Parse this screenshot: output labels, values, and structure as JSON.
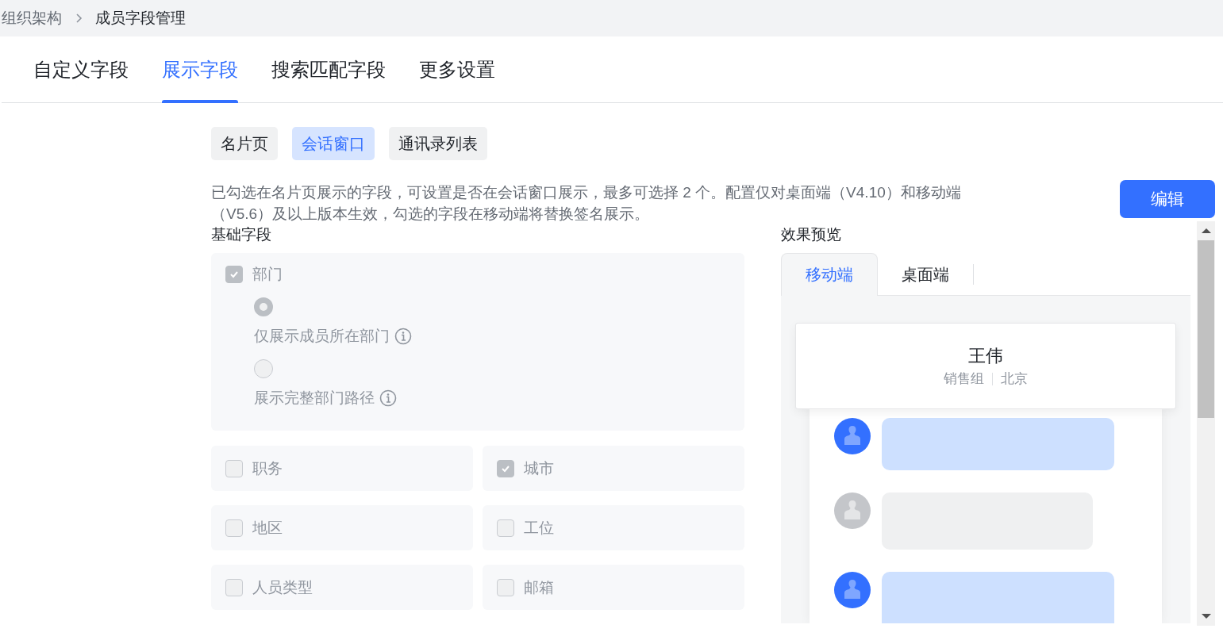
{
  "breadcrumb": [
    {
      "label": "组织架构"
    },
    {
      "label": "成员字段管理"
    }
  ],
  "tabs": [
    {
      "label": "自定义字段",
      "selected": false
    },
    {
      "label": "展示字段",
      "selected": true
    },
    {
      "label": "搜索匹配字段",
      "selected": false
    },
    {
      "label": "更多设置",
      "selected": false
    }
  ],
  "sub_tabs": [
    {
      "label": "名片页",
      "selected": false
    },
    {
      "label": "会话窗口",
      "selected": true
    },
    {
      "label": "通讯录列表",
      "selected": false
    }
  ],
  "description": "已勾选在名片页展示的字段，可设置是否在会话窗口展示，最多可选择 2 个。配置仅对桌面端（V4.10）和移动端（V5.6）及以上版本生效，勾选的字段在移动端将替换签名展示。",
  "edit_button": "编辑",
  "basic_fields": {
    "title": "基础字段",
    "department": {
      "label": "部门",
      "checked": true,
      "options": [
        {
          "label": "仅展示成员所在部门",
          "selected": true
        },
        {
          "label": "展示完整部门路径",
          "selected": false
        }
      ]
    },
    "fields": [
      {
        "label": "职务",
        "checked": false
      },
      {
        "label": "城市",
        "checked": true
      },
      {
        "label": "地区",
        "checked": false
      },
      {
        "label": "工位",
        "checked": false
      },
      {
        "label": "人员类型",
        "checked": false
      },
      {
        "label": "邮箱",
        "checked": false
      }
    ]
  },
  "preview": {
    "title": "效果预览",
    "tabs": [
      {
        "label": "移动端",
        "selected": true
      },
      {
        "label": "桌面端",
        "selected": false
      }
    ],
    "card": {
      "name": "王伟",
      "details": [
        "销售组",
        "北京"
      ]
    },
    "messages": [
      {
        "kind": "self"
      },
      {
        "kind": "other"
      },
      {
        "kind": "self"
      }
    ]
  }
}
